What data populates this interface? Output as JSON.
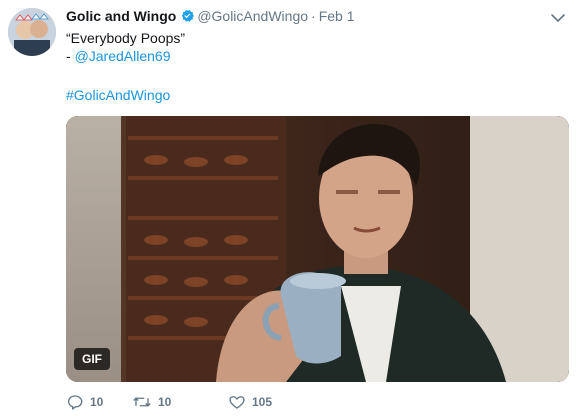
{
  "tweet": {
    "author_name": "Golic and Wingo",
    "handle": "@GolicAndWingo",
    "separator": "·",
    "date": "Feb 1",
    "lines": {
      "quote": "“Everybody Poops”",
      "credit_prefix": "- ",
      "credit_handle": "@JaredAllen69",
      "hashtag": "#GolicAndWingo"
    },
    "media": {
      "badge": "GIF"
    },
    "actions": {
      "replies": "10",
      "retweets": "10",
      "likes": "105"
    },
    "colors": {
      "link": "#1b95e0",
      "verified": "#1da1f2",
      "muted": "#657786"
    },
    "icons": [
      "verified-icon",
      "chevron-down-icon",
      "reply-icon",
      "retweet-icon",
      "like-icon"
    ]
  }
}
